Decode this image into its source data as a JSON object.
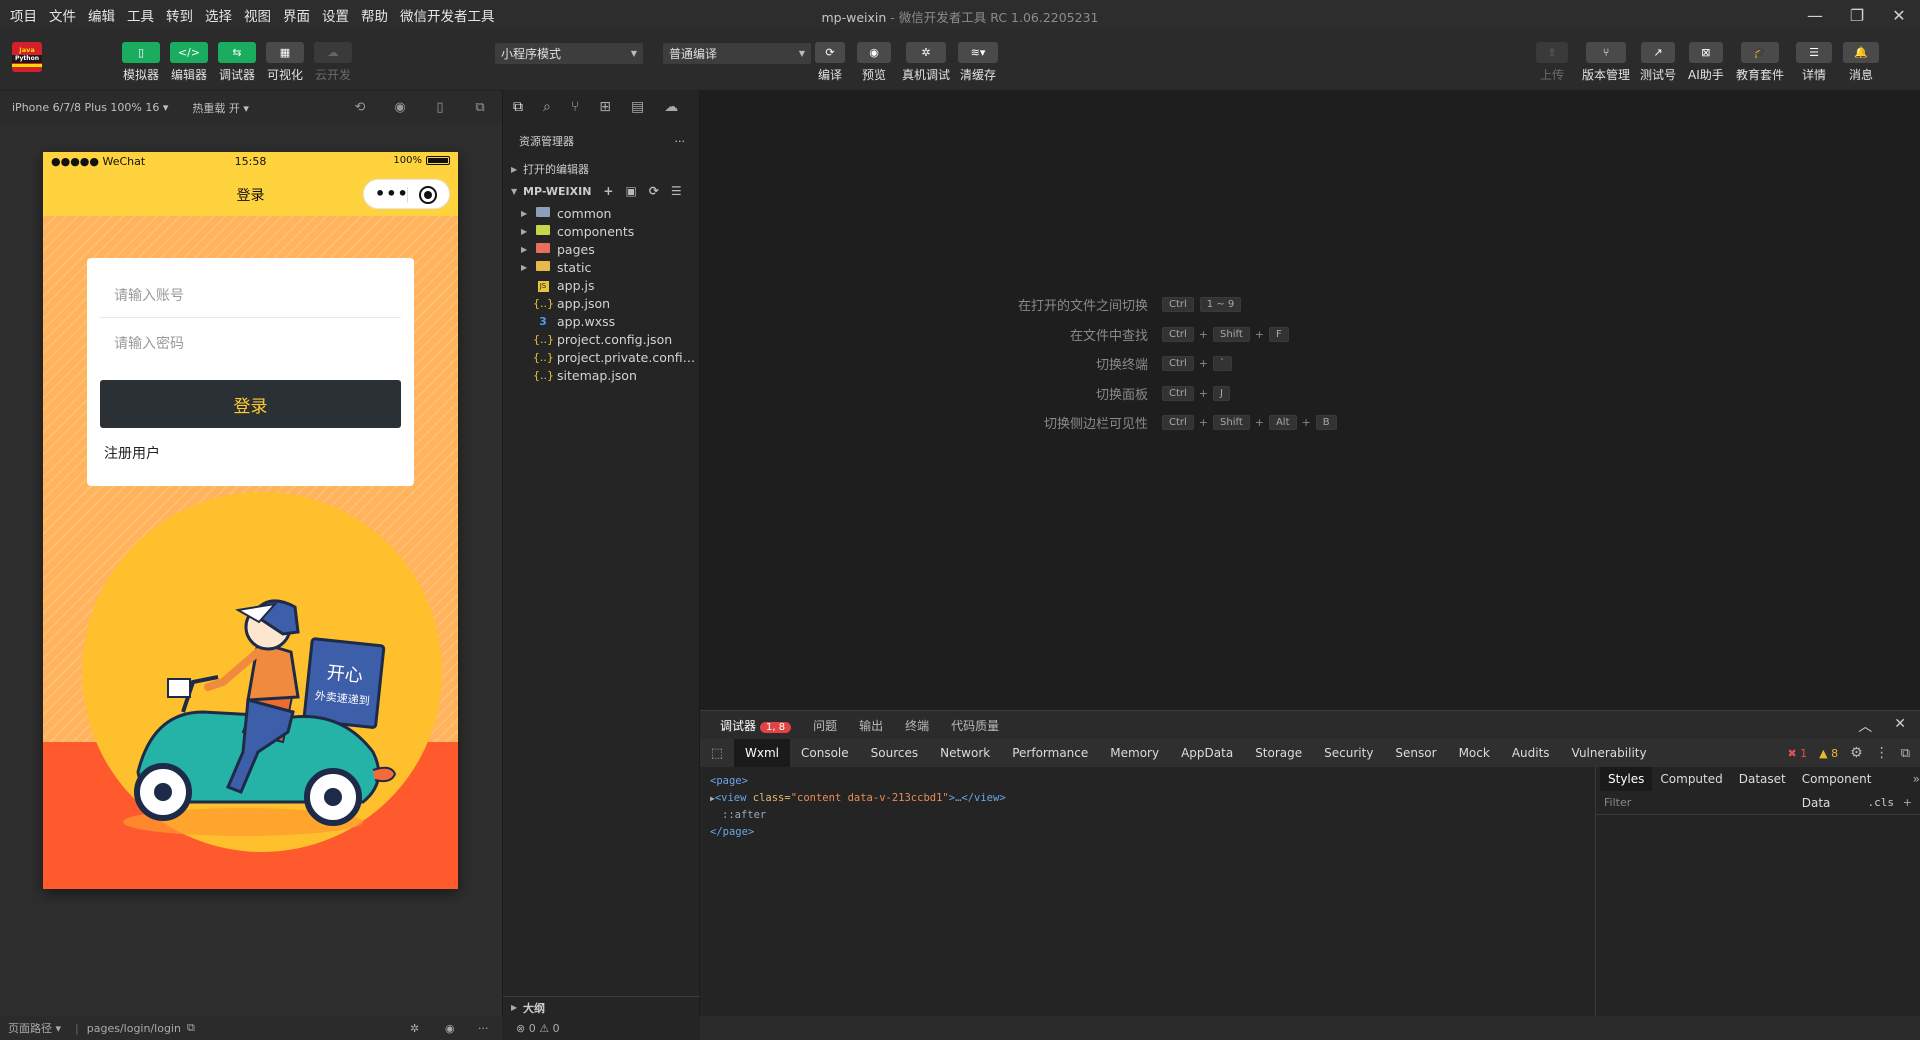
{
  "menu": [
    "项目",
    "文件",
    "编辑",
    "工具",
    "转到",
    "选择",
    "视图",
    "界面",
    "设置",
    "帮助",
    "微信开发者工具"
  ],
  "window": {
    "project": "mp-weixin",
    "app": "微信开发者工具 RC 1.06.2205231"
  },
  "logo": {
    "line1": "Java",
    "line2": "Python"
  },
  "toolbar": {
    "simulator": "模拟器",
    "editor": "编辑器",
    "debugger": "调试器",
    "visual": "可视化",
    "cloud": "云开发",
    "mode_select": "小程序模式",
    "compile_select": "普通编译",
    "compile": "编译",
    "preview": "预览",
    "real_debug": "真机调试",
    "clear_cache": "清缓存",
    "upload": "上传",
    "version": "版本管理",
    "test_account": "测试号",
    "ai": "AI助手",
    "edu": "教育套件",
    "details": "详情",
    "messages": "消息"
  },
  "simbar": {
    "device": "iPhone 6/7/8 Plus 100% 16 ▾",
    "hot_reload": "热重载 开 ▾"
  },
  "phone": {
    "carrier": "●●●●● WeChat",
    "time": "15:58",
    "battery": "100%",
    "nav_title": "登录",
    "account_placeholder": "请输入账号",
    "password_placeholder": "请输入密码",
    "login_button": "登录",
    "register_link": "注册用户",
    "illustration_text1": "开心",
    "illustration_text2": "外卖速递到"
  },
  "sim_footer": {
    "path_label": "页面路径 ▾",
    "path": "pages/login/login"
  },
  "explorer": {
    "title": "资源管理器",
    "more": "···",
    "open_editors": "打开的编辑器",
    "project": "MP-WEIXIN",
    "items": [
      {
        "name": "common",
        "type": "folder"
      },
      {
        "name": "components",
        "type": "folder"
      },
      {
        "name": "pages",
        "type": "folder"
      },
      {
        "name": "static",
        "type": "folder"
      },
      {
        "name": "app.js",
        "type": "js"
      },
      {
        "name": "app.json",
        "type": "json"
      },
      {
        "name": "app.wxss",
        "type": "wxss"
      },
      {
        "name": "project.config.json",
        "type": "json"
      },
      {
        "name": "project.private.config.js...",
        "type": "json"
      },
      {
        "name": "sitemap.json",
        "type": "json"
      }
    ],
    "outline": "大纲",
    "status": "⊗ 0 ⚠ 0"
  },
  "hints": [
    {
      "label": "在打开的文件之间切换",
      "keys": [
        "Ctrl",
        "1 ~ 9"
      ]
    },
    {
      "label": "在文件中查找",
      "keys": [
        "Ctrl",
        "Shift",
        "F"
      ]
    },
    {
      "label": "切换终端",
      "keys": [
        "Ctrl",
        "`"
      ]
    },
    {
      "label": "切换面板",
      "keys": [
        "Ctrl",
        "J"
      ]
    },
    {
      "label": "切换侧边栏可见性",
      "keys": [
        "Ctrl",
        "Shift",
        "Alt",
        "B"
      ]
    }
  ],
  "debug": {
    "tabs": [
      "调试器",
      "问题",
      "输出",
      "终端",
      "代码质量"
    ],
    "badge": "1, 8",
    "devtools_tabs": [
      "Wxml",
      "Console",
      "Sources",
      "Network",
      "Performance",
      "Memory",
      "AppData",
      "Storage",
      "Security",
      "Sensor",
      "Mock",
      "Audits",
      "Vulnerability"
    ],
    "errors": "1",
    "warnings": "8",
    "wxml": {
      "line1": "<page>",
      "view_open": "<view ",
      "attr_name": "class=",
      "attr_value": "\"content data-v-213ccbd1\"",
      "view_close": ">…</view>",
      "after": "::after",
      "line4": "</page>"
    },
    "styles_tabs": [
      "Styles",
      "Computed",
      "Dataset",
      "Component Data"
    ],
    "filter": "Filter",
    "cls": ".cls"
  }
}
